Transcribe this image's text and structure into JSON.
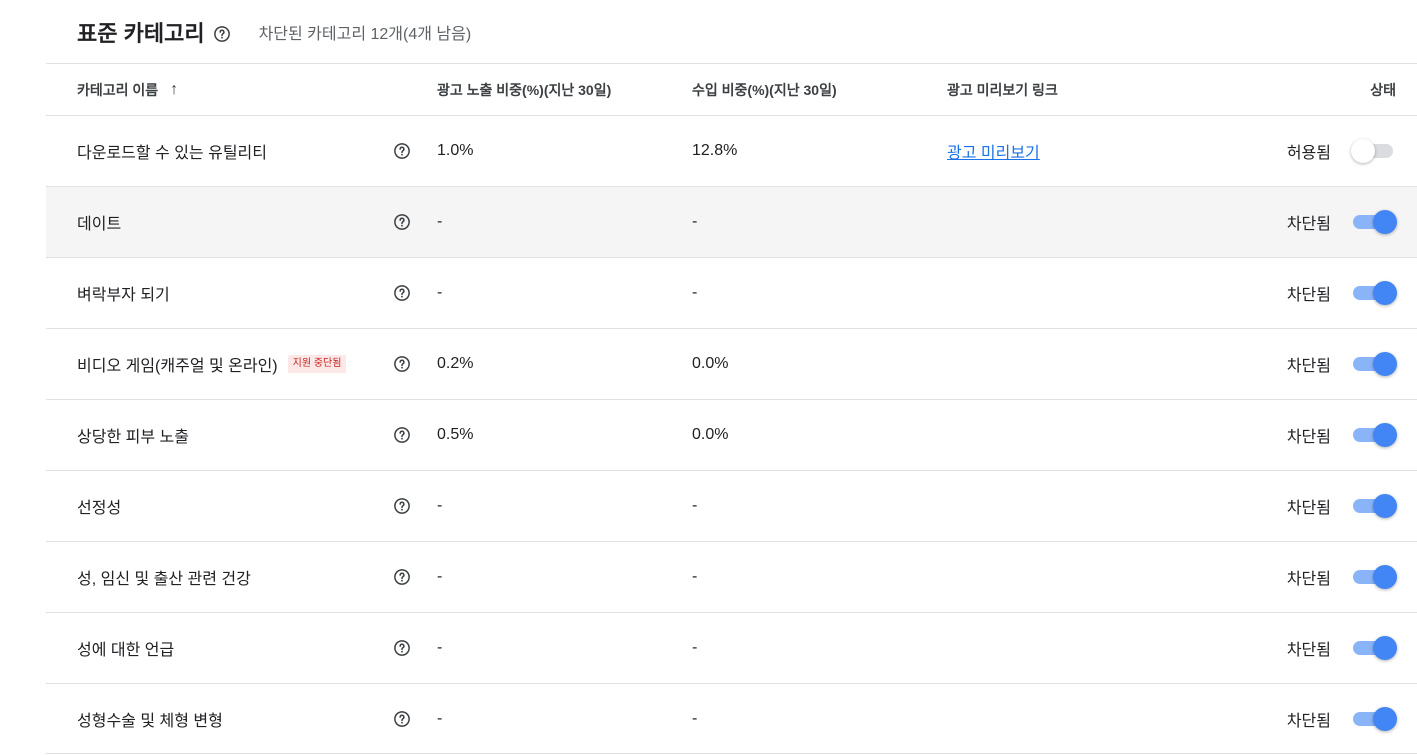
{
  "header": {
    "title": "표준 카테고리",
    "blocked_summary": "차단된 카테고리 12개(4개 남음)"
  },
  "columns": {
    "name": "카테고리 이름",
    "sort_icon": "↑",
    "impression_share": "광고 노출 비중(%)(지난 30일)",
    "revenue_share": "수입 비중(%)(지난 30일)",
    "preview_link": "광고 미리보기 링크",
    "status": "상태"
  },
  "rows": [
    {
      "name": "다운로드할 수 있는 유틸리티",
      "impression": "1.0%",
      "revenue": "12.8%",
      "preview": "광고 미리보기",
      "status": "허용됨",
      "enabled": false
    },
    {
      "name": "데이트",
      "impression": "-",
      "revenue": "-",
      "preview": "",
      "status": "차단됨",
      "enabled": true
    },
    {
      "name": "벼락부자 되기",
      "impression": "-",
      "revenue": "-",
      "preview": "",
      "status": "차단됨",
      "enabled": true
    },
    {
      "name": "비디오 게임(캐주얼 및 온라인)",
      "badge": "지원 중단됨",
      "impression": "0.2%",
      "revenue": "0.0%",
      "preview": "",
      "status": "차단됨",
      "enabled": true
    },
    {
      "name": "상당한 피부 노출",
      "impression": "0.5%",
      "revenue": "0.0%",
      "preview": "",
      "status": "차단됨",
      "enabled": true
    },
    {
      "name": "선정성",
      "impression": "-",
      "revenue": "-",
      "preview": "",
      "status": "차단됨",
      "enabled": true
    },
    {
      "name": "성, 임신 및 출산 관련 건강",
      "impression": "-",
      "revenue": "-",
      "preview": "",
      "status": "차단됨",
      "enabled": true
    },
    {
      "name": "성에 대한 언급",
      "impression": "-",
      "revenue": "-",
      "preview": "",
      "status": "차단됨",
      "enabled": true
    },
    {
      "name": "성형수술 및 체형 변형",
      "impression": "-",
      "revenue": "-",
      "preview": "",
      "status": "차단됨",
      "enabled": true
    }
  ],
  "icons": {
    "help": "help-circle-icon",
    "sort": "arrow-up-icon"
  },
  "colors": {
    "accent": "#4285f4",
    "link": "#1a73e8",
    "badge_bg": "#fce8e6",
    "badge_text": "#c5221f"
  }
}
